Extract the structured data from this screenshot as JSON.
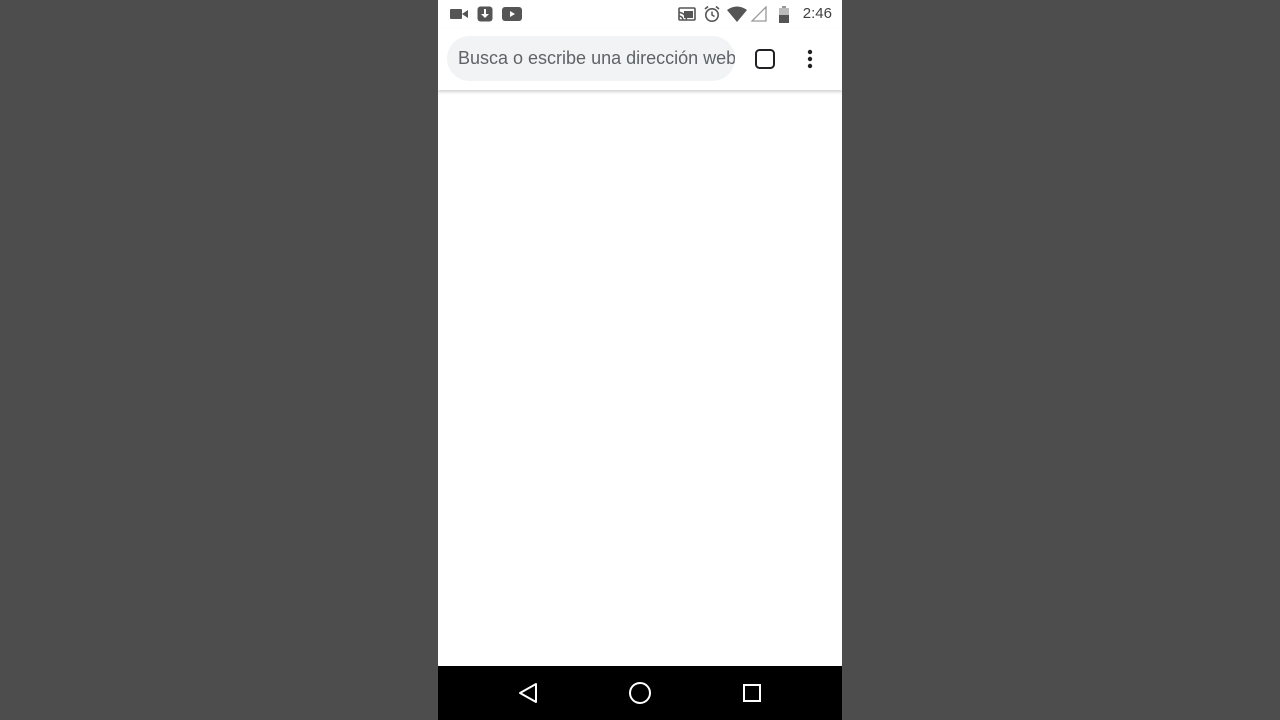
{
  "status_bar": {
    "time": "2:46",
    "left_icons": [
      "video-camera-icon",
      "download-icon",
      "youtube-icon"
    ],
    "right_icons": [
      "cast-icon",
      "alarm-icon",
      "wifi-icon",
      "signal-icon",
      "battery-icon"
    ]
  },
  "toolbar": {
    "omnibox_placeholder": "Busca o escribe una dirección web",
    "tab_count": ""
  },
  "nav_bar": {
    "buttons": [
      "back-icon",
      "home-icon",
      "recents-icon"
    ]
  },
  "colors": {
    "outer_background": "#4d4d4d",
    "omnibox_background": "#f1f3f4",
    "placeholder_text": "#5f6368",
    "nav_bar": "#000000"
  }
}
